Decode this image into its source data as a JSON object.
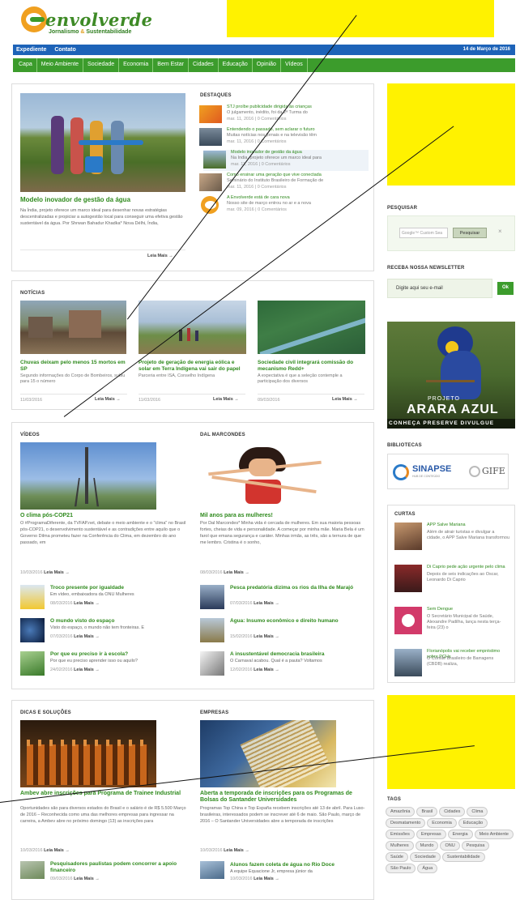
{
  "header": {
    "logo_name": "envolverde",
    "logo_tag_1": "Jornalismo",
    "logo_tag_amp": "&",
    "logo_tag_2": "Sustentabilidade"
  },
  "topbar": {
    "links": [
      "Expediente",
      "Contato"
    ],
    "date": "14 de Março de 2016"
  },
  "nav": [
    "Capa",
    "Meio Ambiente",
    "Sociedade",
    "Economia",
    "Bem Estar",
    "Cidades",
    "Educação",
    "Opinião",
    "Vídeos"
  ],
  "featured": {
    "title": "Modelo inovador de gestão da água",
    "excerpt": "Na Índia, projeto oferece um marco ideal para desenhar novas estratégias descentralizadas e propiciar a autogestão local para conseguir uma efetiva gestão sustentável da água. Por Shrwan Bahadur Khadka* Nova Délhi, Índia,",
    "more": "Leia Mais →"
  },
  "destaques": {
    "heading": "DESTAQUES",
    "items": [
      {
        "title": "STJ proíbe publicidade dirigida às crianças",
        "excerpt": "O julgamento, inédito, foi da 2ª Turma do",
        "meta": "mar. 11, 2016 | 0 Comentários"
      },
      {
        "title": "Entendendo o passado, sem aclarar o futuro",
        "excerpt": "Muitas notícias nos jornais e na televisão têm",
        "meta": "mar. 11, 2016 | 0 Comentários"
      },
      {
        "title": "Modelo inovador de gestão da água",
        "excerpt": "Na Índia, projeto oferece um marco ideal para",
        "meta": "mar. 11, 2016 | 0 Comentários"
      },
      {
        "title": "Como ensinar uma geração que vive conectada",
        "excerpt": "Seminário do Instituto Brasileiro de Formação de",
        "meta": "mar. 11, 2016 | 0 Comentários"
      },
      {
        "title": "A Envolverde está de cara nova",
        "excerpt": "Nosso site de março entrou no ar e a nova",
        "meta": "mar. 09, 2016 | 0 Comentários"
      }
    ]
  },
  "noticias": {
    "heading": "NOTÍCIAS",
    "items": [
      {
        "title": "Chuvas deixam pelo menos 15 mortos em SP",
        "excerpt": "Segundo informações do Corpo de Bombeiros, subiu para 15 o número",
        "date": "11/03/2016",
        "more": "Leia Mais →"
      },
      {
        "title": "Projeto de geração de energia eólica e solar em Terra Indígena vai sair do papel",
        "excerpt": "Parceria entre ISA, Conselho Indígena",
        "date": "11/03/2016",
        "more": "Leia Mais →"
      },
      {
        "title": "Sociedade civil integrará comissão do mecanismo Redd+",
        "excerpt": "A expectativa é que a seleção contemple a participação dos diversos",
        "date": "09/03/2016",
        "more": "Leia Mais →"
      }
    ]
  },
  "videos": {
    "heading": "VÍDEOS",
    "main_title": "O clima pós-COP21",
    "main_excerpt": "O #ProgramaDiferente, da TVFAP.net, debate o meio ambiente e o \"clima\" no Brasil pós-COP21, o desenvolvimento sustentável e as contradições entre aquilo que o Governo Dilma prometeu fazer na Conferência do Clima, em dezembro do ano passado, em",
    "main_meta": "10/03/2016",
    "more": "Leia Mais →",
    "items": [
      {
        "title": "Troco presente por igualdade",
        "excerpt": "Em vídeo, embaixadora da ONU Mulheres",
        "date": "08/03/2016"
      },
      {
        "title": "O mundo visto do espaço",
        "excerpt": "Visto do espaço, o mundo não tem fronteiras. E",
        "date": "07/03/2016"
      },
      {
        "title": "Por que eu preciso ir à escola?",
        "excerpt": "Por que eu preciso aprender isso ou aquilo?",
        "date": "24/02/2016"
      }
    ]
  },
  "dal": {
    "heading": "DAL MARCONDES",
    "main_title": "Mil anos para as mulheres!",
    "main_excerpt": "Por Dal Marcondes* Minha vida é cercada de mulheres. Em sua maioria pessoas fortes, cheias de vida e personalidade. A começar por minha mãe. Maria Bela é um farol que emana segurança e caráter. Minhas irmãs, as três, são a ternura de que me lembro. Cristina é o sonho,",
    "main_meta": "08/03/2016",
    "items": [
      {
        "title": "Pesca predatória dizima os rios da Ilha de Marajó",
        "excerpt": "",
        "date": "07/03/2016"
      },
      {
        "title": "Água: Insumo econômico e direito humano",
        "excerpt": "",
        "date": "15/02/2016"
      },
      {
        "title": "A insustentável democracia brasileira",
        "excerpt": "O Carnaval acabou. Qual é a pauta? Voltamos",
        "date": "12/02/2016"
      }
    ]
  },
  "dicas": {
    "heading": "DICAS E SOLUÇÕES",
    "main_title": "Ambev abre inscrições para Programa de Trainee Industrial",
    "main_excerpt": "Oportunidades são para diversos estados do Brasil e o salário é de R$ 5.500 Março de 2016 – Reconhecida como uma das melhores empresas para ingressar na carreira, a Ambev abre no próximo domingo (13) as inscrições para",
    "main_meta": "10/03/2016",
    "items": [
      {
        "title": "Pesquisadores paulistas podem concorrer a apoio financeiro",
        "date": "09/03/2016"
      }
    ]
  },
  "empresas": {
    "heading": "EMPRESAS",
    "main_title": "Aberta a temporada de inscrições para os Programas de Bolsas do Santander Universidades",
    "main_excerpt": "Programas Top China e Top España recebem inscrições até 13 de abril. Para Luso-brasileiras, interessados podem se inscrever até 6 de maio. São Paulo, março de 2016 – O Santander Universidades abre a temporada de inscrições",
    "main_meta": "10/03/2016",
    "items": [
      {
        "title": "Alunos fazem coleta de água no Rio Doce",
        "excerpt": "A equipe Equacione Jr, empresa júnior da",
        "date": "10/03/2016"
      }
    ]
  },
  "sidebar": {
    "search_heading": "PESQUISAR",
    "search_placeholder": "Google™ Custom Sea",
    "search_button": "Pesquisar",
    "search_clear": "×",
    "newsletter_heading": "RECEBA NOSSA NEWSLETTER",
    "newsletter_placeholder": "Digite aqui seu e-mail",
    "newsletter_button": "Ok",
    "banner_small": "PROJETO",
    "banner_title": "ARARA AZUL",
    "banner_sub": "CONHEÇA PRESERVE DIVULGUE",
    "biblio_heading": "BIBLIOTECAS",
    "biblio_1": "SINAPSE",
    "biblio_1_sub": "HUB DE CONTEÚDO",
    "biblio_2": "GIFE",
    "curtas_heading": "CURTAS",
    "curtas": [
      {
        "title": "APP Salve Mariana",
        "excerpt": "Além de atrair turistas e divulgar a cidade, o APP Salve Mariana transformou"
      },
      {
        "title": "Di Caprio pede ação urgente pelo clima",
        "excerpt": "Depois de seis indicações ao Oscar, Leonardo Di Caprio"
      },
      {
        "title": "Sem Dengue",
        "excerpt": "O Secretário Municipal de Saúde, Alexandre Padilha, lança nesta terça-feira (23) o"
      },
      {
        "title": "Florianópolis vai receber empréstimo sobre PCHs",
        "excerpt": "O Comitê Brasileiro de Barragens (CBDB) realiza,"
      }
    ],
    "tags_heading": "TAGS",
    "tags": [
      "Amazônia",
      "Brasil",
      "Cidades",
      "Clima",
      "Desmatamento",
      "Economia",
      "Educação",
      "Emissões",
      "Empresas",
      "Energia",
      "Meio Ambiente",
      "Mulheres",
      "Mundo",
      "ONU",
      "Pesquisa",
      "Saúde",
      "Sociedade",
      "Sustentabilidade",
      "São Paulo",
      "Água"
    ]
  },
  "colors": {
    "green": "#3c9c2c",
    "blue": "#1d63b8",
    "yellow": "#fff200",
    "title_green": "#2f8a1d"
  }
}
